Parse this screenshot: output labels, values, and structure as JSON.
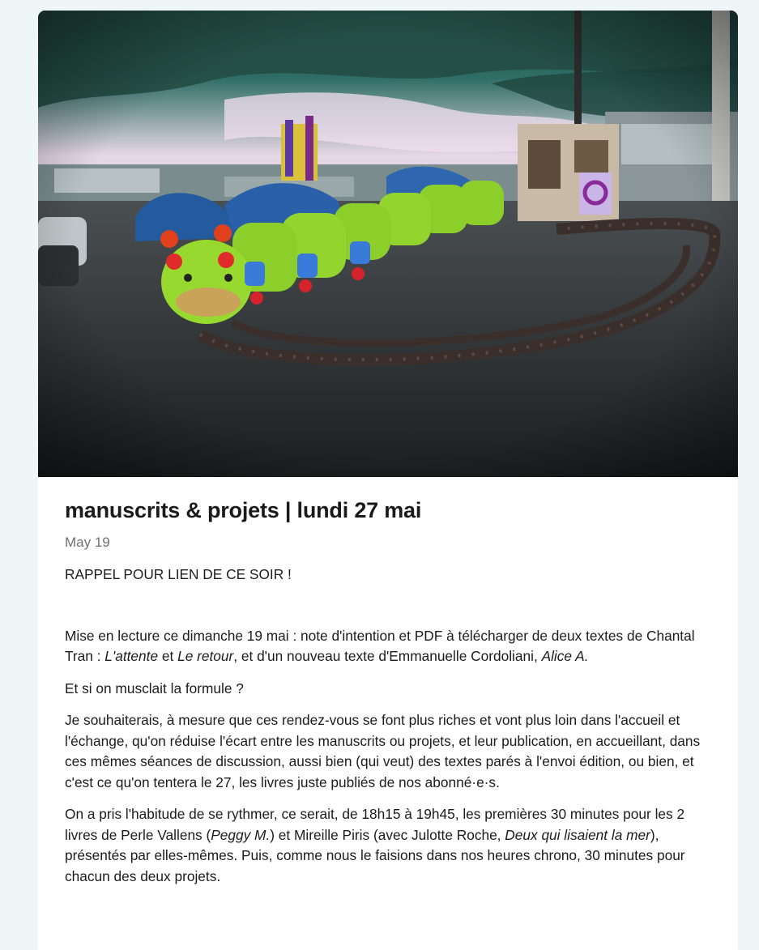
{
  "post": {
    "hero_image": "caterpillar-kiddie-train-photo",
    "title": "manuscrits & projets | lundi 27 mai",
    "date": "May 19",
    "recall": "RAPPEL POUR LIEN DE CE SOIR !",
    "mise": {
      "t1": "Mise en lecture ce dimanche 19 mai : note d'intention et PDF à télécharger de deux textes de Chantal Tran : ",
      "i1": "L'attente",
      "t2": " et ",
      "i2": "Le retour",
      "t3": ", et d'un nouveau texte d'Emmanuelle Cordoliani, ",
      "i3": "Alice A."
    },
    "question": "Et si on musclait la formule ?",
    "para_wish": "Je souhaiterais, à mesure que ces rendez-vous se font plus riches et vont plus loin dans l'accueil et l'échange, qu'on réduise l'écart entre les manuscrits ou projets, et leur publication, en accueillant, dans ces mêmes séances de discussion, aussi bien (qui veut) des textes parés à l'envoi édition, ou bien, et c'est ce qu'on tentera le 27, les livres juste publiés de nos abonné·e·s.",
    "rythme": {
      "t1": "On a pris l'habitude de se rythmer, ce serait, de 18h15 à 19h45, les premières 30 minutes pour les 2 livres de Perle Vallens (",
      "i1": "Peggy M.",
      "t2": ") et Mireille Piris (avec Julotte Roche, ",
      "i2": "Deux qui lisaient la mer",
      "t3": "), présentés par elles-mêmes. Puis, comme nous le faisions dans nos heures chrono, 30 minutes pour chacun des deux projets."
    }
  },
  "colors": {
    "page_bg": "#eef6f8",
    "card_bg": "#ffffff",
    "date": "#707070",
    "caterpillar_green": "#8ccf2a"
  }
}
